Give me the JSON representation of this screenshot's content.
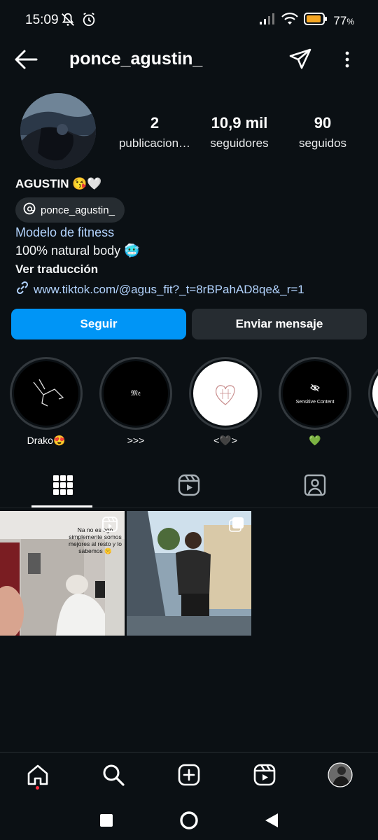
{
  "status_bar": {
    "time": "15:09",
    "battery": "77",
    "battery_suffix": "%",
    "icons_left": [
      "mute-icon",
      "alarm-icon"
    ],
    "icons_right": [
      "signal-icon",
      "wifi-icon",
      "battery-icon"
    ]
  },
  "header": {
    "username": "ponce_agustin_",
    "icons": [
      "back-arrow-icon",
      "send-icon",
      "more-vertical-icon"
    ]
  },
  "profile": {
    "stats": [
      {
        "value": "2",
        "label": "publicacion…"
      },
      {
        "value": "10,9 mil",
        "label": "seguidores"
      },
      {
        "value": "90",
        "label": "seguidos"
      }
    ],
    "display_name": "AGUSTIN 😘🤍",
    "threads_handle": "ponce_agustin_",
    "category": "Modelo de fitness",
    "bio": "100% natural body 🥶",
    "see_translation": "Ver traducción",
    "link": "www.tiktok.com/@agus_fit?_t=8rBPahAD8qe&_r=1"
  },
  "actions": {
    "follow": "Seguir",
    "message": "Enviar mensaje"
  },
  "highlights": [
    {
      "label": "Drako😍",
      "cover_text": ""
    },
    {
      "label": ">>>",
      "cover_text": "𝔐𝔢"
    },
    {
      "label": "<🖤>",
      "cover_text": ""
    },
    {
      "label": "💚",
      "cover_text": "Sensitive Content"
    }
  ],
  "tabs": [
    "grid-icon",
    "reels-icon",
    "tagged-icon"
  ],
  "posts": [
    {
      "overlay_text": "Na no es ego simplemente somos mejores al resto y lo sabemos 🤫",
      "type_icon": "reel-icon"
    },
    {
      "overlay_text": "",
      "type_icon": "carousel-icon"
    }
  ],
  "bottom_nav": [
    "home-icon",
    "search-icon",
    "create-icon",
    "reels-icon",
    "profile-avatar"
  ],
  "colors": {
    "background": "#0b1014",
    "primary_button": "#0095f6",
    "secondary_button": "#262c31",
    "link": "#b3d4ff"
  }
}
